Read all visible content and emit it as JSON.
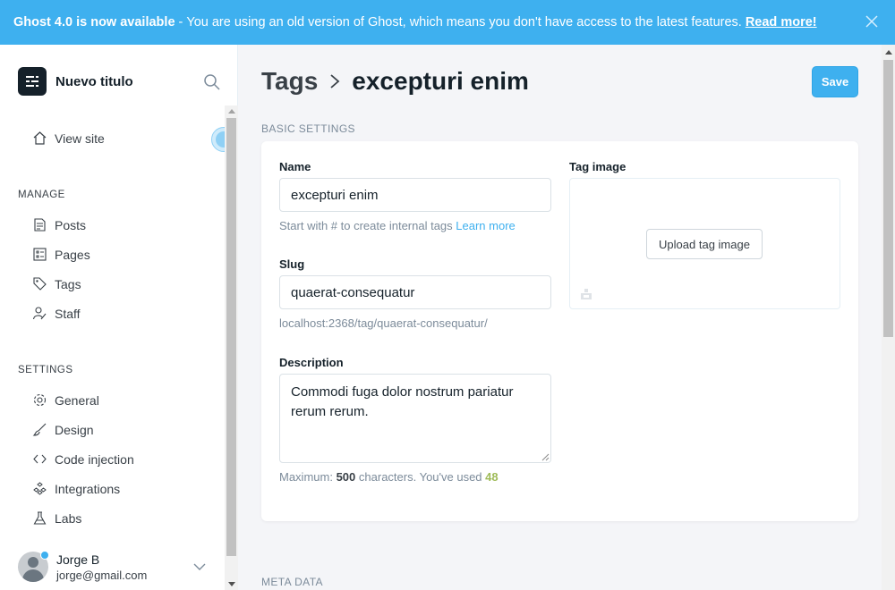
{
  "banner": {
    "headline": "Ghost 4.0 is now available",
    "separator": "-",
    "message": "You are using an old version of Ghost, which means you don't have access to the latest features.",
    "link": "Read more!"
  },
  "sidebar": {
    "site_title": "Nuevo titulo",
    "view_site": "View site",
    "manage_title": "MANAGE",
    "manage_items": [
      {
        "label": "Posts",
        "icon": "posts-icon"
      },
      {
        "label": "Pages",
        "icon": "pages-icon"
      },
      {
        "label": "Tags",
        "icon": "tag-icon"
      },
      {
        "label": "Staff",
        "icon": "staff-icon"
      }
    ],
    "settings_title": "SETTINGS",
    "settings_items": [
      {
        "label": "General",
        "icon": "gear-icon"
      },
      {
        "label": "Design",
        "icon": "brush-icon"
      },
      {
        "label": "Code injection",
        "icon": "code-icon"
      },
      {
        "label": "Integrations",
        "icon": "integrations-icon"
      },
      {
        "label": "Labs",
        "icon": "flask-icon"
      }
    ],
    "user": {
      "name": "Jorge B",
      "email": "jorge@gmail.com"
    }
  },
  "header": {
    "breadcrumb_parent": "Tags",
    "breadcrumb_current": "excepturi enim",
    "save_label": "Save"
  },
  "basic_settings": {
    "title": "BASIC SETTINGS",
    "name_label": "Name",
    "name_value": "excepturi enim",
    "name_help": "Start with # to create internal tags",
    "name_help_link": "Learn more",
    "slug_label": "Slug",
    "slug_value": "quaerat-consequatur",
    "slug_url": "localhost:2368/tag/quaerat-consequatur/",
    "description_label": "Description",
    "description_value": "Commodi fuga dolor nostrum pariatur rerum rerum.",
    "desc_help_prefix": "Maximum:",
    "desc_max": "500",
    "desc_help_middle": "characters. You've used",
    "desc_used": "48",
    "tag_image_label": "Tag image",
    "upload_label": "Upload tag image"
  },
  "meta_data": {
    "title": "META DATA"
  },
  "colors": {
    "accent": "#3eb0ef",
    "used_count": "#9fbb58",
    "dark": "#15212a"
  }
}
